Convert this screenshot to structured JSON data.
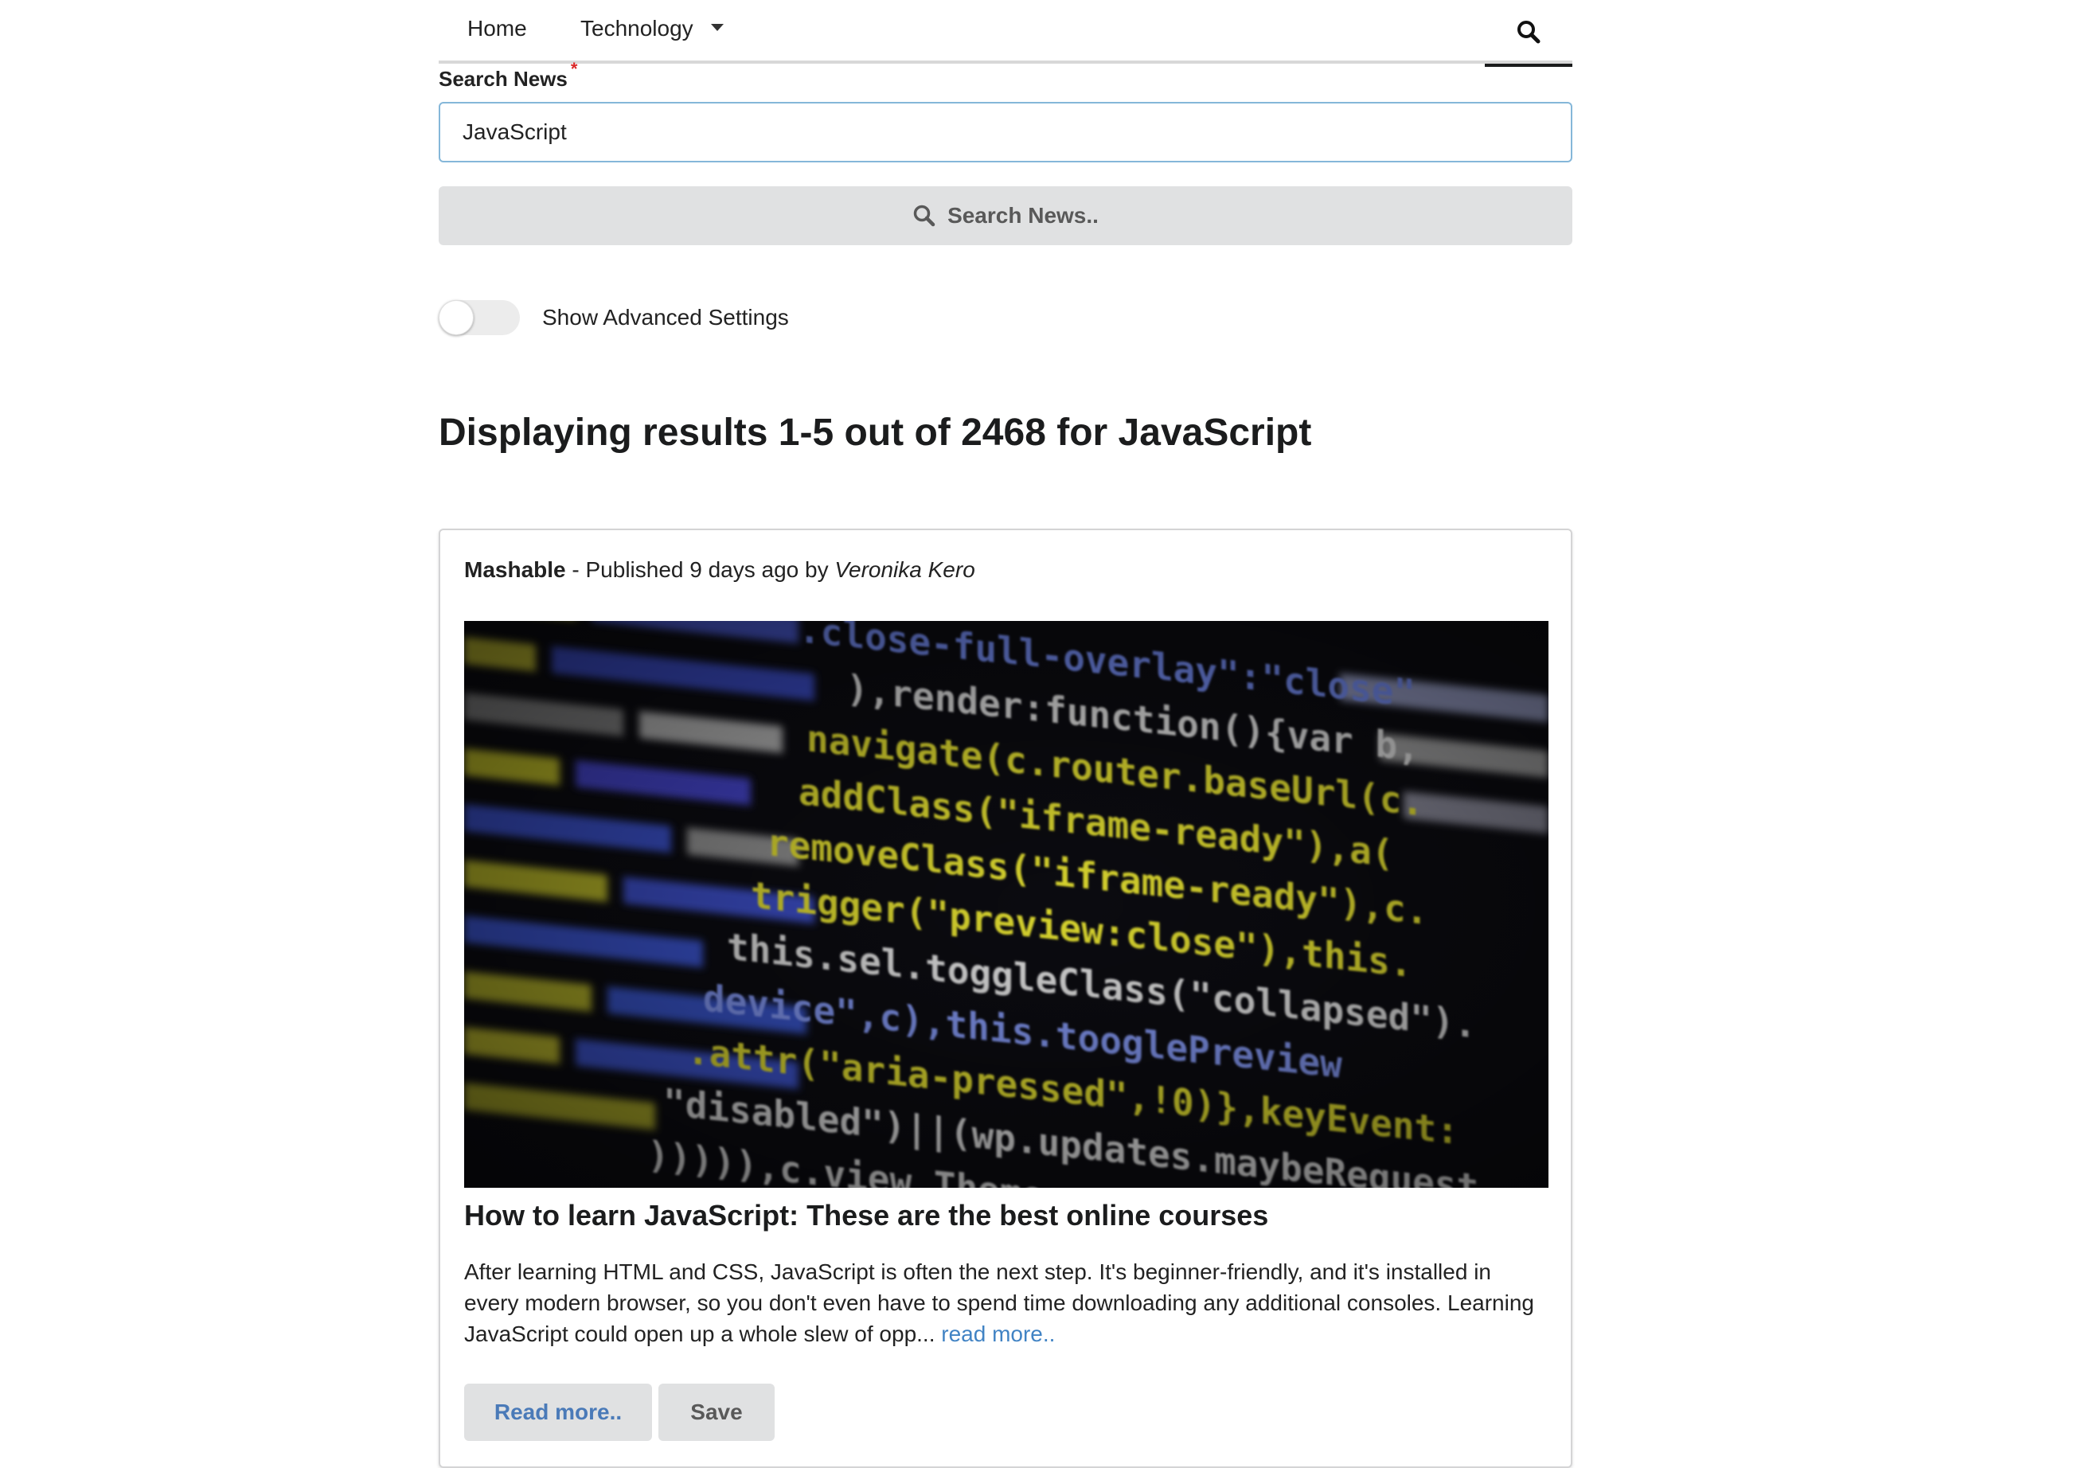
{
  "nav": {
    "home_label": "Home",
    "technology_label": "Technology"
  },
  "search": {
    "label": "Search News",
    "required_mark": "*",
    "value": "JavaScript",
    "button_label": "Search News.."
  },
  "advanced": {
    "toggle_label": "Show Advanced Settings",
    "enabled": false
  },
  "results": {
    "heading": "Displaying results 1-5 out of 2468 for JavaScript",
    "articles": [
      {
        "source": "Mashable",
        "published_prefix": " - Published 9 days ago by ",
        "author": "Veronika Kero",
        "image_icon": "code-screenshot-image",
        "title": "How to learn JavaScript: These are the best online courses",
        "description": "After learning HTML and CSS, JavaScript is often the next step. It's beginner-friendly, and it's installed in every modern browser, so you don't even have to spend time downloading any additional consoles. Learning JavaScript could open up a whole slew of opp... ",
        "inline_link": "read more..",
        "read_more_label": "Read more..",
        "save_label": "Save"
      }
    ]
  },
  "colors": {
    "accent_link": "#4183c4",
    "input_focus_border": "#85b7d9",
    "required": "#db2828",
    "button_bg": "#e0e1e2"
  }
}
